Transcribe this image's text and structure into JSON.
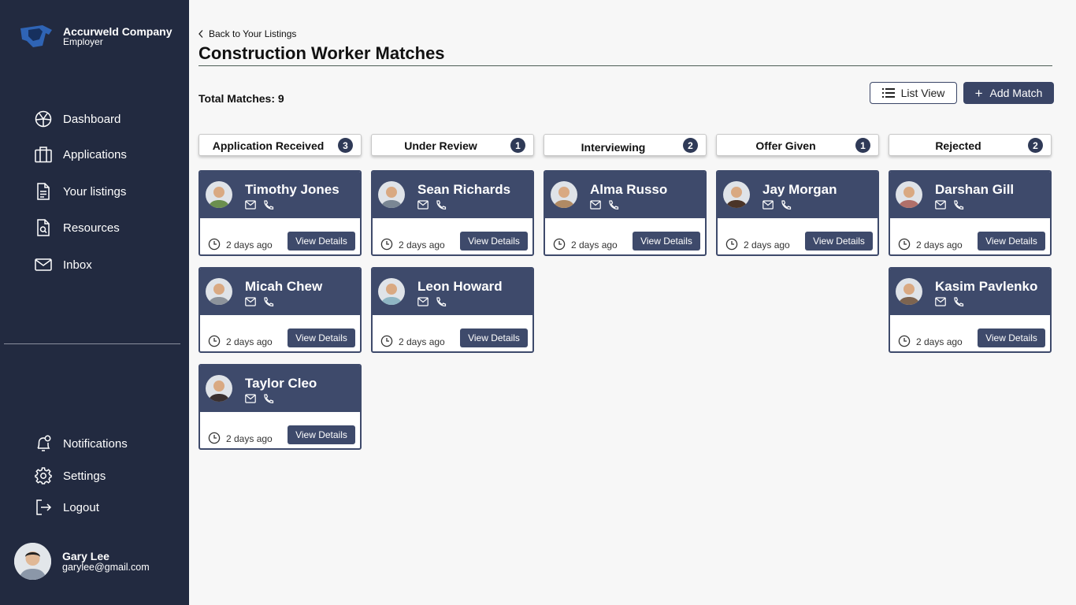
{
  "company": {
    "name": "Accurweld Company",
    "role": "Employer"
  },
  "nav": [
    {
      "label": "Dashboard",
      "icon": "dashboard-icon"
    },
    {
      "label": "Applications",
      "icon": "briefcase-icon"
    },
    {
      "label": "Your listings",
      "icon": "document-icon"
    },
    {
      "label": "Resources",
      "icon": "file-search-icon"
    },
    {
      "label": "Inbox",
      "icon": "mail-icon"
    }
  ],
  "bottom_nav": [
    {
      "label": "Notifications",
      "icon": "bell-icon"
    },
    {
      "label": "Settings",
      "icon": "gear-icon"
    },
    {
      "label": "Logout",
      "icon": "logout-icon"
    }
  ],
  "user": {
    "name": "Gary Lee",
    "email": "garylee@gmail.com"
  },
  "back_label": "Back to Your Listings",
  "page_title": "Construction Worker Matches",
  "total_matches": "Total Matches: 9",
  "list_view_label": "List View",
  "add_match_label": "Add Match",
  "columns": [
    {
      "label": "Application Received",
      "count": "3"
    },
    {
      "label": "Under Review",
      "count": "1"
    },
    {
      "label": "Interviewing",
      "count": "2"
    },
    {
      "label": "Offer Given",
      "count": "1"
    },
    {
      "label": "Rejected",
      "count": "2"
    }
  ],
  "cards": [
    {
      "name": "Timothy Jones",
      "time": "2 days ago",
      "action": "View Details",
      "avatar_color": "#6b8f4e"
    },
    {
      "name": "Sean Richards",
      "time": "2 days ago",
      "action": "View Details",
      "avatar_color": "#7a8794"
    },
    {
      "name": "Alma Russo",
      "time": "2 days ago",
      "action": "View Details",
      "avatar_color": "#b08a64"
    },
    {
      "name": "Jay Morgan",
      "time": "2 days ago",
      "action": "View Details",
      "avatar_color": "#4a3428"
    },
    {
      "name": "Darshan Gill",
      "time": "2 days ago",
      "action": "View Details",
      "avatar_color": "#b0706a"
    },
    {
      "name": "Micah Chew",
      "time": "2 days ago",
      "action": "View Details",
      "avatar_color": "#8d939b"
    },
    {
      "name": "Leon Howard",
      "time": "2 days ago",
      "action": "View Details",
      "avatar_color": "#8fb6c4"
    },
    {
      "name": "Kasim Pavlenko",
      "time": "2 days ago",
      "action": "View Details",
      "avatar_color": "#7d6450"
    },
    {
      "name": "Taylor Cleo",
      "time": "2 days ago",
      "action": "View Details",
      "avatar_color": "#3a3030"
    }
  ]
}
